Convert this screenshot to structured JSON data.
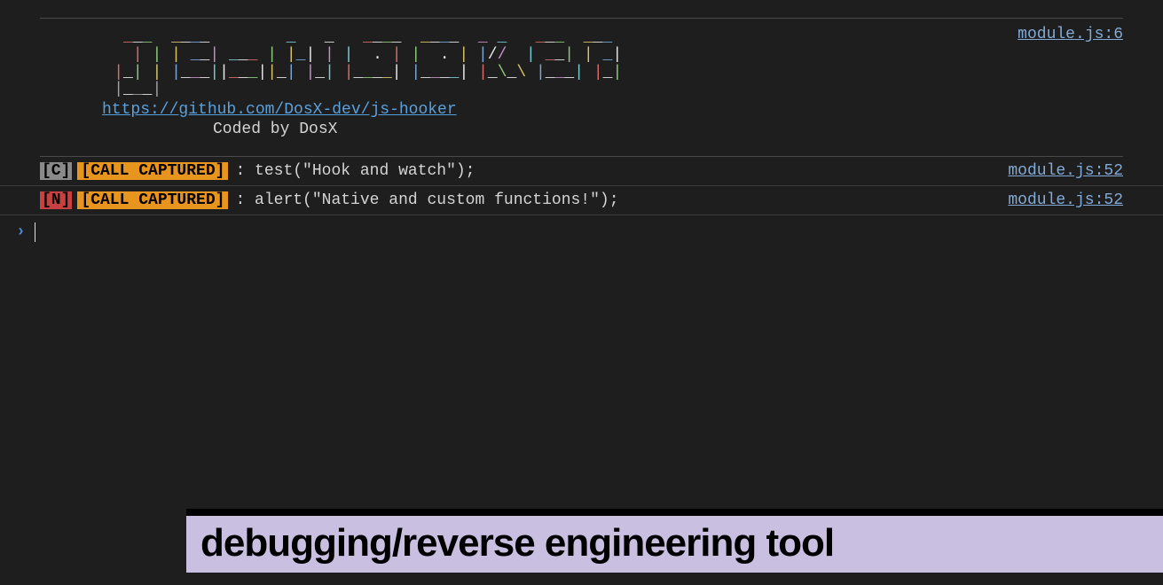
{
  "header": {
    "source_link": "module.js:6",
    "repo_url": "https://github.com/DosX-dev/js-hooker",
    "coded_by": "Coded by DosX"
  },
  "logs": [
    {
      "type_label": "[C]",
      "type": "C",
      "capture_label": "[CALL CAPTURED]",
      "message": " : test(\"Hook and watch\");",
      "source": "module.js:52"
    },
    {
      "type_label": "[N]",
      "type": "N",
      "capture_label": "[CALL CAPTURED]",
      "message": " : alert(\"Native and custom functions!\");",
      "source": "module.js:52"
    }
  ],
  "prompt": {
    "chevron": "›",
    "value": ""
  },
  "banner": {
    "text": "debugging/reverse engineering tool"
  },
  "colors": {
    "bg": "#1e1e1e",
    "link": "#5aa0dd",
    "capture_bg": "#e8951f",
    "native_bg": "#c84040",
    "custom_bg": "#8a8a8a",
    "banner_bg": "#c9bfe0"
  }
}
